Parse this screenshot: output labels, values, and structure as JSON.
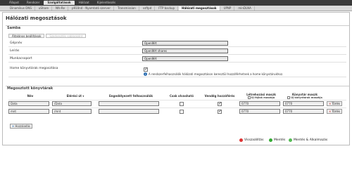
{
  "topnav": {
    "tabs": [
      "Állapot",
      "Rendszer",
      "Szolgáltatások",
      "Hálózat",
      "Kijelentkezés"
    ],
    "active_index": 2
  },
  "subnav": {
    "tabs": [
      "Dinamikus DNS",
      "uShare",
      "Nfs-Re",
      "p910nd - Nyomtató szerver",
      "Transmission",
      "vsftpd",
      "FTP backup",
      "Hálózati megosztások",
      "UPNP",
      "minDLNA"
    ],
    "active_index": 7
  },
  "page": {
    "title": "Hálózati megosztások"
  },
  "samba": {
    "section_label": "Samba",
    "tabs": [
      "Általános beállítások",
      "Szerkesztés sablonként"
    ],
    "fields": {
      "hostname_label": "Gépnév",
      "hostname_value": "OpenWrt",
      "description_label": "Leírás",
      "description_value": "OpenWrt shares",
      "workgroup_label": "Munkacsoport",
      "workgroup_value": "OpenWrt",
      "homes_label": "Home könyvtárak megosztása",
      "homes_hint": "A rendszerfelhasználók hálózati megosztáson keresztül hozzáférhetnek a home könyvtárukhoz."
    }
  },
  "shares": {
    "section_label": "Megosztott könyvtárak",
    "columns": {
      "name": "Név",
      "path": "Elérési út",
      "users": "Engedélyezett felhasználók",
      "readonly": "Csak olvasható",
      "guest": "Vendég hozzáférés",
      "create_mask": "Létrehozási maszk",
      "dir_mask": "Könyvtár maszk"
    },
    "create_mask_sub": "Új fájlok maszkja",
    "dir_mask_sub": "Új könyvtárak maszkja",
    "rows": [
      {
        "name": "Data",
        "path": "/Data",
        "users": "",
        "create_mask": "0770",
        "dir_mask": "0770",
        "delete_label": "Törlés"
      },
      {
        "name": "mnt",
        "path": "/mnt",
        "users": "",
        "create_mask": "0770",
        "dir_mask": "0770",
        "delete_label": "Törlés"
      }
    ],
    "add_label": "Hozzáadás"
  },
  "footer": {
    "reset_label": "Visszaállítás",
    "save_label": "Mentés",
    "save_apply_label": "Mentés & Alkalmazás"
  }
}
